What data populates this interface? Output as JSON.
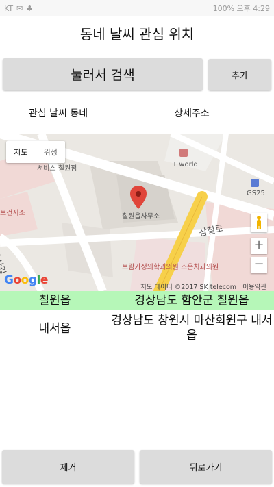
{
  "status_bar": {
    "left_text": "KT",
    "right_text": "100% 오후 4:29"
  },
  "screen": {
    "title": "동네 날씨 관심 위치",
    "search_button": "눌러서 검색",
    "add_button": "추가",
    "column_headers": [
      "관심 날씨 동네",
      "상세주소"
    ]
  },
  "map": {
    "type_toggle": [
      "지도",
      "위성"
    ],
    "labels": {
      "service": "서비스 칠원점",
      "tworld": "T world",
      "gs25": "GS25",
      "health_center": "보건지소",
      "office": "칠원읍사무소",
      "road_samchil": "삼칠로",
      "road_yongsan": "용산길",
      "clinic": "보람가정의학과의원 조은치과의원"
    },
    "zoom_in": "+",
    "zoom_out": "−",
    "google_logo": "Google",
    "attribution": "지도 데이터 ©2017 SK telecom",
    "terms": "이용약관"
  },
  "locations": [
    {
      "name": "칠원읍",
      "address": "경상남도 함안군 칠원읍",
      "highlighted": true
    },
    {
      "name": "내서읍",
      "address": "경상남도 창원시 마산회원구 내서읍",
      "highlighted": false
    }
  ],
  "bottom": {
    "remove_button": "제거",
    "back_button": "뒤로가기"
  },
  "colors": {
    "selected_row": "#b6f7b8",
    "button_bg": "#dcdcdc",
    "map_pin": "#e0453a",
    "highlight_road": "#f7d04a"
  }
}
